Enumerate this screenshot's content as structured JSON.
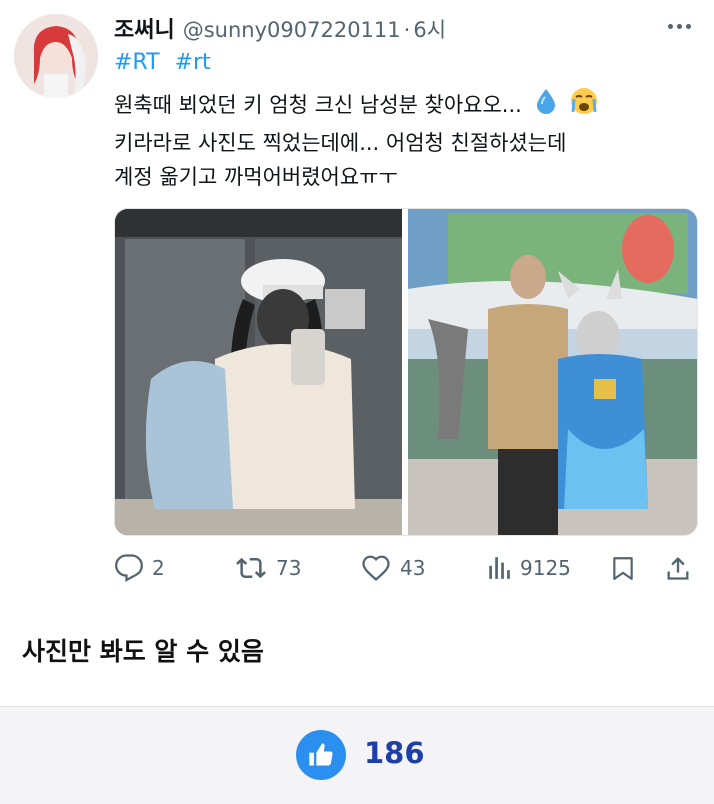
{
  "tweet": {
    "display_name": "조써니",
    "handle": "@sunny0907220111",
    "separator": "·",
    "time": "6시",
    "hashtags": [
      "#RT",
      "#rt"
    ],
    "lines": [
      "원축때 뵈었던 키 엄청 크신 남성분 찾아요오...",
      "키라라로 사진도 찍었는데에... 어엄청 친절하셨는데",
      "계정 옮기고 까먹어버렸어요ㅠㅜ"
    ],
    "emojis": [
      "droplet-emoji",
      "crying-face-emoji"
    ],
    "media": {
      "photo_left": "mirror-selfie-photo",
      "photo_right": "cosplayer-pose-photo"
    },
    "actions": {
      "replies": "2",
      "retweets": "73",
      "likes": "43",
      "views": "9125"
    }
  },
  "comment": {
    "text": "사진만 봐도 알 수 있음"
  },
  "like_bar": {
    "count": "186",
    "icon": "thumbs-up-icon"
  },
  "colors": {
    "link": "#1d9bf0",
    "secondary": "#536471",
    "like_blue": "#2b8ff0",
    "like_count": "#1f3fa8"
  }
}
